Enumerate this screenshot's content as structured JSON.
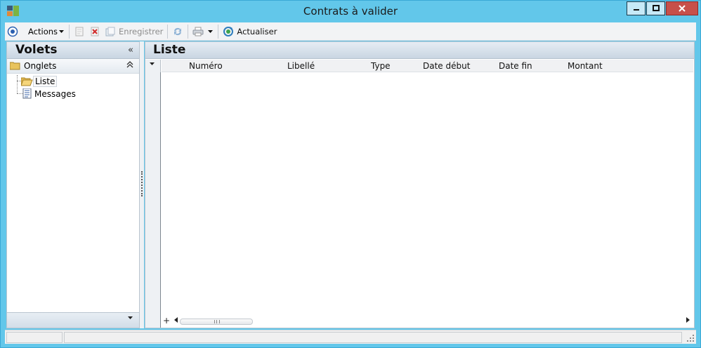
{
  "window": {
    "title": "Contrats à valider",
    "controls": {
      "minimize": "minimize",
      "maximize": "maximize",
      "close": "close"
    }
  },
  "toolbar": {
    "actions_label": "Actions",
    "save_label": "Enregistrer",
    "refresh_label": "Actualiser"
  },
  "left_panel": {
    "title": "Volets",
    "collapse_glyph": "«",
    "group": {
      "label": "Onglets",
      "toggle_glyph": "⌃"
    },
    "items": [
      {
        "label": "Liste",
        "icon": "folder-open-icon",
        "selected": true
      },
      {
        "label": "Messages",
        "icon": "document-icon",
        "selected": false
      }
    ]
  },
  "main": {
    "title": "Liste",
    "columns": [
      "Numéro",
      "Libellé",
      "Type",
      "Date début",
      "Date fin",
      "Montant"
    ],
    "rows": [],
    "scroll_add_glyph": "+"
  },
  "status": {
    "pane1": "",
    "pane2": ""
  },
  "colors": {
    "window_frame": "#62c7ea",
    "close_button": "#c7504a",
    "panel_header": "#c9d6e2"
  }
}
